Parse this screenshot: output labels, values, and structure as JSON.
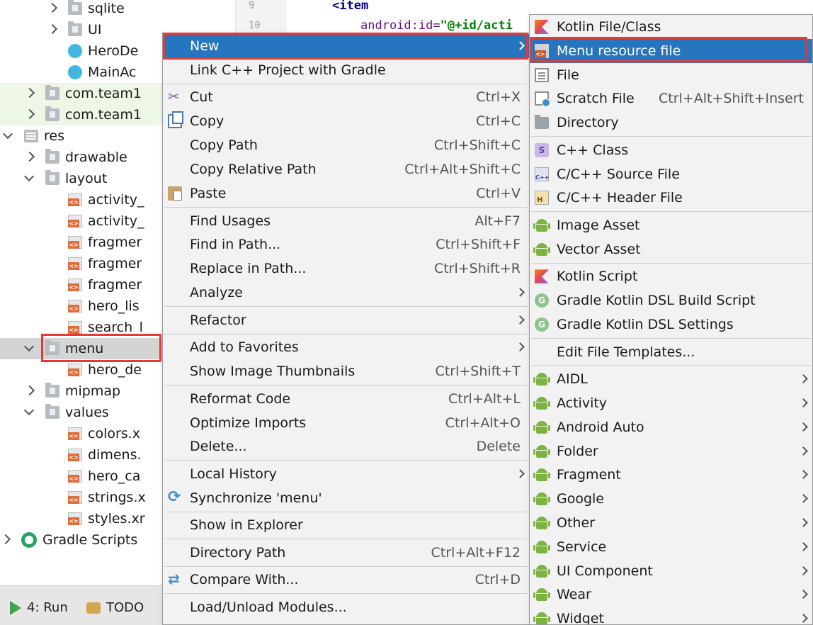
{
  "tree": {
    "rows": [
      {
        "label": "sqlite",
        "indent": 96,
        "arrow": "r",
        "icon": "folder"
      },
      {
        "label": "UI",
        "indent": 96,
        "arrow": "r",
        "icon": "folder"
      },
      {
        "label": "HeroDe",
        "indent": 96,
        "arrow": "none",
        "icon": "class"
      },
      {
        "label": "MainAc",
        "indent": 96,
        "arrow": "none",
        "icon": "class"
      },
      {
        "label": "com.team1",
        "indent": 64,
        "arrow": "r",
        "icon": "folder",
        "green": true
      },
      {
        "label": "com.team1",
        "indent": 64,
        "arrow": "r",
        "icon": "folder",
        "green": true
      },
      {
        "label": "res",
        "indent": 34,
        "arrow": "d",
        "icon": "resfolder"
      },
      {
        "label": "drawable",
        "indent": 64,
        "arrow": "r",
        "icon": "folder"
      },
      {
        "label": "layout",
        "indent": 64,
        "arrow": "d",
        "icon": "folder"
      },
      {
        "label": "activity_",
        "indent": 96,
        "arrow": "none",
        "icon": "xml"
      },
      {
        "label": "activity_",
        "indent": 96,
        "arrow": "none",
        "icon": "xml"
      },
      {
        "label": "fragmer",
        "indent": 96,
        "arrow": "none",
        "icon": "xml"
      },
      {
        "label": "fragmer",
        "indent": 96,
        "arrow": "none",
        "icon": "xml"
      },
      {
        "label": "fragmer",
        "indent": 96,
        "arrow": "none",
        "icon": "xml"
      },
      {
        "label": "hero_lis",
        "indent": 96,
        "arrow": "none",
        "icon": "xml"
      },
      {
        "label": "search_l",
        "indent": 96,
        "arrow": "none",
        "icon": "xml"
      },
      {
        "label": "menu",
        "indent": 64,
        "arrow": "d",
        "icon": "folder",
        "selected": true
      },
      {
        "label": "hero_de",
        "indent": 96,
        "arrow": "none",
        "icon": "xml"
      },
      {
        "label": "mipmap",
        "indent": 64,
        "arrow": "r",
        "icon": "folder"
      },
      {
        "label": "values",
        "indent": 64,
        "arrow": "d",
        "icon": "folder"
      },
      {
        "label": "colors.x",
        "indent": 96,
        "arrow": "none",
        "icon": "xml"
      },
      {
        "label": "dimens.",
        "indent": 96,
        "arrow": "none",
        "icon": "xml"
      },
      {
        "label": "hero_ca",
        "indent": 96,
        "arrow": "none",
        "icon": "xml"
      },
      {
        "label": "strings.x",
        "indent": 96,
        "arrow": "none",
        "icon": "xml"
      },
      {
        "label": "styles.xr",
        "indent": 96,
        "arrow": "none",
        "icon": "xml"
      },
      {
        "label": "Gradle Scripts",
        "indent": 4,
        "arrow": "r",
        "icon": "gradle"
      }
    ]
  },
  "editor": {
    "line_numbers": [
      "9",
      "10"
    ],
    "line1_tag": "<item",
    "line2_attr": "android:id=",
    "line2_value": "\"@+id/acti"
  },
  "bottombar": {
    "run_label": "4: Run",
    "todo_label": "TODO"
  },
  "context_menu": {
    "items": [
      {
        "label": "New",
        "submenu": true,
        "highlighted": true,
        "icon": ""
      },
      {
        "label": "Link C++ Project with Gradle",
        "icon": ""
      },
      {
        "sep": true
      },
      {
        "label": "Cut",
        "shortcut": "Ctrl+X",
        "icon": "cut"
      },
      {
        "label": "Copy",
        "shortcut": "Ctrl+C",
        "icon": "copy"
      },
      {
        "label": "Copy Path",
        "shortcut": "Ctrl+Shift+C",
        "icon": ""
      },
      {
        "label": "Copy Relative Path",
        "shortcut": "Ctrl+Alt+Shift+C",
        "icon": ""
      },
      {
        "label": "Paste",
        "shortcut": "Ctrl+V",
        "icon": "paste"
      },
      {
        "sep": true
      },
      {
        "label": "Find Usages",
        "shortcut": "Alt+F7",
        "icon": ""
      },
      {
        "label": "Find in Path...",
        "shortcut": "Ctrl+Shift+F",
        "icon": ""
      },
      {
        "label": "Replace in Path...",
        "shortcut": "Ctrl+Shift+R",
        "icon": ""
      },
      {
        "label": "Analyze",
        "submenu": true,
        "icon": ""
      },
      {
        "sep": true
      },
      {
        "label": "Refactor",
        "submenu": true,
        "icon": ""
      },
      {
        "sep": true
      },
      {
        "label": "Add to Favorites",
        "submenu": true,
        "icon": ""
      },
      {
        "label": "Show Image Thumbnails",
        "shortcut": "Ctrl+Shift+T",
        "icon": ""
      },
      {
        "sep": true
      },
      {
        "label": "Reformat Code",
        "shortcut": "Ctrl+Alt+L",
        "icon": ""
      },
      {
        "label": "Optimize Imports",
        "shortcut": "Ctrl+Alt+O",
        "icon": ""
      },
      {
        "label": "Delete...",
        "shortcut": "Delete",
        "icon": ""
      },
      {
        "sep": true
      },
      {
        "label": "Local History",
        "submenu": true,
        "icon": ""
      },
      {
        "label": "Synchronize 'menu'",
        "icon": "sync"
      },
      {
        "sep": true
      },
      {
        "label": "Show in Explorer",
        "icon": ""
      },
      {
        "sep": true
      },
      {
        "label": "Directory Path",
        "shortcut": "Ctrl+Alt+F12",
        "icon": ""
      },
      {
        "sep": true
      },
      {
        "label": "Compare With...",
        "shortcut": "Ctrl+D",
        "icon": "compare"
      },
      {
        "sep": true
      },
      {
        "label": "Load/Unload Modules...",
        "icon": ""
      }
    ]
  },
  "new_submenu": {
    "items": [
      {
        "label": "Kotlin File/Class",
        "icon": "kotlin"
      },
      {
        "label": "Menu resource file",
        "icon": "menures",
        "highlighted": true
      },
      {
        "label": "File",
        "icon": "file"
      },
      {
        "label": "Scratch File",
        "shortcut": "Ctrl+Alt+Shift+Insert",
        "icon": "scratch"
      },
      {
        "label": "Directory",
        "icon": "dir"
      },
      {
        "sep": true
      },
      {
        "label": "C++ Class",
        "icon": "cppclass"
      },
      {
        "label": "C/C++ Source File",
        "icon": "cppsrc"
      },
      {
        "label": "C/C++ Header File",
        "icon": "cpph"
      },
      {
        "sep": true
      },
      {
        "label": "Image Asset",
        "icon": "android"
      },
      {
        "label": "Vector Asset",
        "icon": "android"
      },
      {
        "sep": true
      },
      {
        "label": "Kotlin Script",
        "icon": "kotlin"
      },
      {
        "label": "Gradle Kotlin DSL Build Script",
        "icon": "gradle"
      },
      {
        "label": "Gradle Kotlin DSL Settings",
        "icon": "gradle"
      },
      {
        "sep": true
      },
      {
        "label": "Edit File Templates...",
        "icon": ""
      },
      {
        "sep": true
      },
      {
        "label": "AIDL",
        "icon": "android",
        "submenu": true
      },
      {
        "label": "Activity",
        "icon": "android",
        "submenu": true
      },
      {
        "label": "Android Auto",
        "icon": "android",
        "submenu": true
      },
      {
        "label": "Folder",
        "icon": "android",
        "submenu": true
      },
      {
        "label": "Fragment",
        "icon": "android",
        "submenu": true
      },
      {
        "label": "Google",
        "icon": "android",
        "submenu": true
      },
      {
        "label": "Other",
        "icon": "android",
        "submenu": true
      },
      {
        "label": "Service",
        "icon": "android",
        "submenu": true
      },
      {
        "label": "UI Component",
        "icon": "android",
        "submenu": true
      },
      {
        "label": "Wear",
        "icon": "android",
        "submenu": true
      },
      {
        "label": "Widget",
        "icon": "android",
        "submenu": true
      }
    ]
  },
  "colors": {
    "highlight": "#2675bf",
    "annotation_red": "#e53935",
    "package_green_bg": "#eef7e6"
  }
}
